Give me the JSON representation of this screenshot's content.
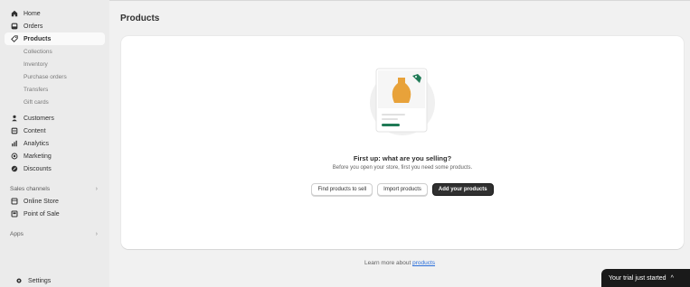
{
  "sidebar": {
    "primary": [
      {
        "label": "Home",
        "icon": "home-icon"
      },
      {
        "label": "Orders",
        "icon": "orders-icon"
      },
      {
        "label": "Products",
        "icon": "tag-icon",
        "active": true
      }
    ],
    "product_sub": [
      "Collections",
      "Inventory",
      "Purchase orders",
      "Transfers",
      "Gift cards"
    ],
    "secondary": [
      {
        "label": "Customers",
        "icon": "person-icon"
      },
      {
        "label": "Content",
        "icon": "content-icon"
      },
      {
        "label": "Analytics",
        "icon": "bar-chart-icon"
      },
      {
        "label": "Marketing",
        "icon": "target-icon"
      },
      {
        "label": "Discounts",
        "icon": "discount-icon"
      }
    ],
    "sales_channels_label": "Sales channels",
    "channels": [
      {
        "label": "Online Store",
        "icon": "store-icon"
      },
      {
        "label": "Point of Sale",
        "icon": "pos-icon"
      }
    ],
    "apps_label": "Apps",
    "settings_label": "Settings"
  },
  "page": {
    "title": "Products"
  },
  "empty_state": {
    "title": "First up: what are you selling?",
    "subtitle": "Before you open your store, first you need some products.",
    "find_button": "Find products to sell",
    "import_button": "Import products",
    "add_button": "Add your products"
  },
  "footer": {
    "learn_prefix": "Learn more about",
    "learn_link": "products"
  },
  "trial": {
    "label": "Your trial just started"
  },
  "colors": {
    "accent_dark": "#303030",
    "link": "#2a6fdb",
    "vase": "#e8a23a",
    "tag_green": "#1f7a56"
  }
}
